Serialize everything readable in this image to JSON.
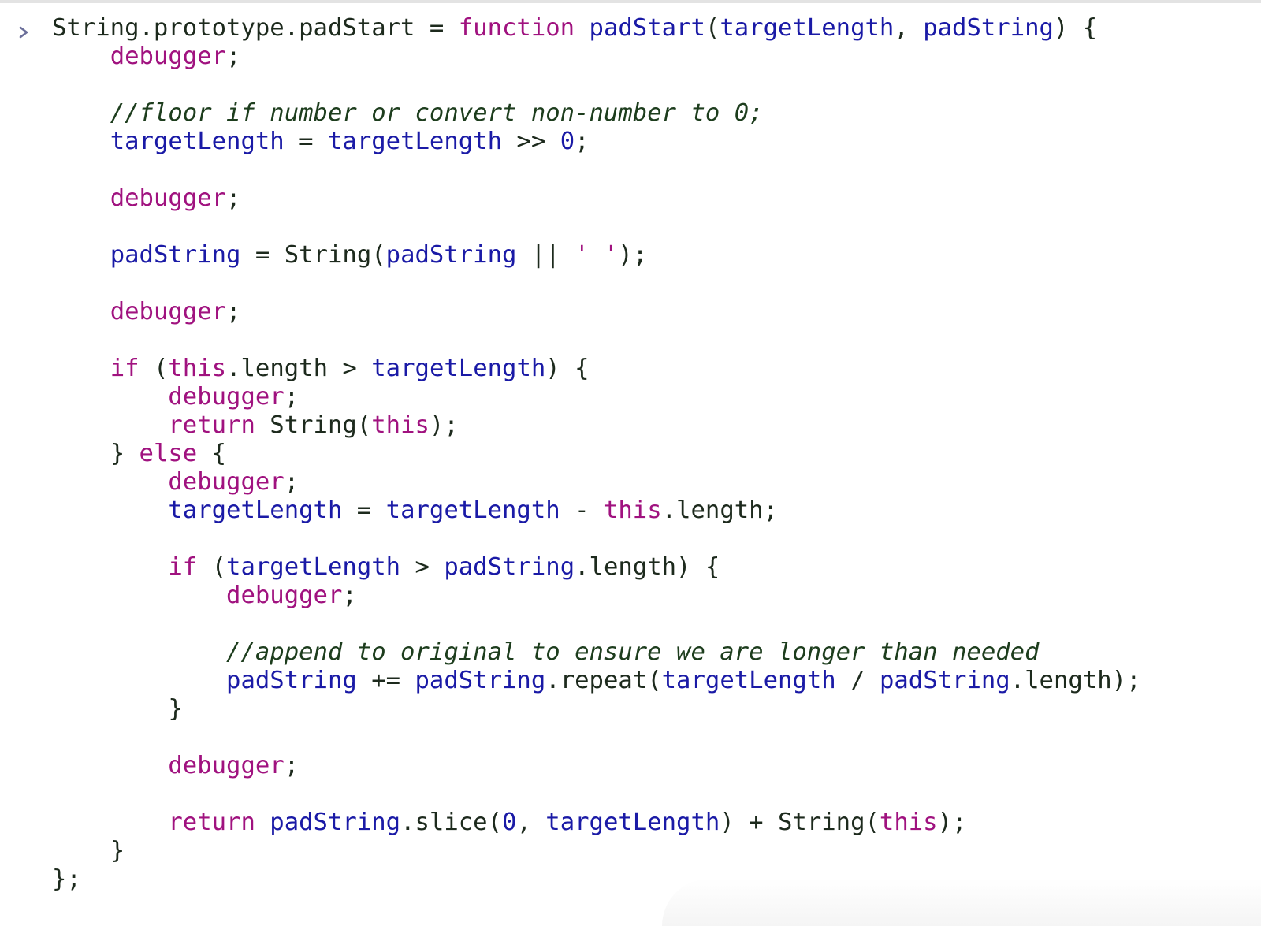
{
  "console": {
    "prompt_icon": "chevron-right-icon",
    "colors": {
      "keyword": "#a0127f",
      "variable": "#1a1aa6",
      "plain": "#1d2a1d",
      "comment": "#1d3d1d"
    },
    "lines": [
      {
        "indent": 0,
        "tokens": [
          {
            "t": "String.prototype.",
            "c": "plain"
          },
          {
            "t": "padStart",
            "c": "plain"
          },
          {
            "t": " = ",
            "c": "plain"
          },
          {
            "t": "function",
            "c": "kw"
          },
          {
            "t": " ",
            "c": "plain"
          },
          {
            "t": "padStart",
            "c": "var"
          },
          {
            "t": "(",
            "c": "plain"
          },
          {
            "t": "targetLength",
            "c": "var"
          },
          {
            "t": ", ",
            "c": "plain"
          },
          {
            "t": "padString",
            "c": "var"
          },
          {
            "t": ") {",
            "c": "plain"
          }
        ]
      },
      {
        "indent": 1,
        "tokens": [
          {
            "t": "debugger",
            "c": "kw"
          },
          {
            "t": ";",
            "c": "plain"
          }
        ]
      },
      {
        "indent": 0,
        "tokens": []
      },
      {
        "indent": 1,
        "tokens": [
          {
            "t": "//floor if number or convert non-number to 0;",
            "c": "comment"
          }
        ]
      },
      {
        "indent": 1,
        "tokens": [
          {
            "t": "targetLength",
            "c": "var"
          },
          {
            "t": " = ",
            "c": "plain"
          },
          {
            "t": "targetLength",
            "c": "var"
          },
          {
            "t": " >> ",
            "c": "plain"
          },
          {
            "t": "0",
            "c": "num"
          },
          {
            "t": ";",
            "c": "plain"
          }
        ]
      },
      {
        "indent": 0,
        "tokens": []
      },
      {
        "indent": 1,
        "tokens": [
          {
            "t": "debugger",
            "c": "kw"
          },
          {
            "t": ";",
            "c": "plain"
          }
        ]
      },
      {
        "indent": 0,
        "tokens": []
      },
      {
        "indent": 1,
        "tokens": [
          {
            "t": "padString",
            "c": "var"
          },
          {
            "t": " = String(",
            "c": "plain"
          },
          {
            "t": "padString",
            "c": "var"
          },
          {
            "t": " || ",
            "c": "plain"
          },
          {
            "t": "' '",
            "c": "str"
          },
          {
            "t": ");",
            "c": "plain"
          }
        ]
      },
      {
        "indent": 0,
        "tokens": []
      },
      {
        "indent": 1,
        "tokens": [
          {
            "t": "debugger",
            "c": "kw"
          },
          {
            "t": ";",
            "c": "plain"
          }
        ]
      },
      {
        "indent": 0,
        "tokens": []
      },
      {
        "indent": 1,
        "tokens": [
          {
            "t": "if",
            "c": "kw"
          },
          {
            "t": " (",
            "c": "plain"
          },
          {
            "t": "this",
            "c": "kw"
          },
          {
            "t": ".length > ",
            "c": "plain"
          },
          {
            "t": "targetLength",
            "c": "var"
          },
          {
            "t": ") {",
            "c": "plain"
          }
        ]
      },
      {
        "indent": 2,
        "tokens": [
          {
            "t": "debugger",
            "c": "kw"
          },
          {
            "t": ";",
            "c": "plain"
          }
        ]
      },
      {
        "indent": 2,
        "tokens": [
          {
            "t": "return",
            "c": "kw"
          },
          {
            "t": " String(",
            "c": "plain"
          },
          {
            "t": "this",
            "c": "kw"
          },
          {
            "t": ");",
            "c": "plain"
          }
        ]
      },
      {
        "indent": 1,
        "tokens": [
          {
            "t": "} ",
            "c": "plain"
          },
          {
            "t": "else",
            "c": "kw"
          },
          {
            "t": " {",
            "c": "plain"
          }
        ]
      },
      {
        "indent": 2,
        "tokens": [
          {
            "t": "debugger",
            "c": "kw"
          },
          {
            "t": ";",
            "c": "plain"
          }
        ]
      },
      {
        "indent": 2,
        "tokens": [
          {
            "t": "targetLength",
            "c": "var"
          },
          {
            "t": " = ",
            "c": "plain"
          },
          {
            "t": "targetLength",
            "c": "var"
          },
          {
            "t": " - ",
            "c": "plain"
          },
          {
            "t": "this",
            "c": "kw"
          },
          {
            "t": ".length;",
            "c": "plain"
          }
        ]
      },
      {
        "indent": 0,
        "tokens": []
      },
      {
        "indent": 2,
        "tokens": [
          {
            "t": "if",
            "c": "kw"
          },
          {
            "t": " (",
            "c": "plain"
          },
          {
            "t": "targetLength",
            "c": "var"
          },
          {
            "t": " > ",
            "c": "plain"
          },
          {
            "t": "padString",
            "c": "var"
          },
          {
            "t": ".length) {",
            "c": "plain"
          }
        ]
      },
      {
        "indent": 3,
        "tokens": [
          {
            "t": "debugger",
            "c": "kw"
          },
          {
            "t": ";",
            "c": "plain"
          }
        ]
      },
      {
        "indent": 0,
        "tokens": []
      },
      {
        "indent": 3,
        "tokens": [
          {
            "t": "//append to original to ensure we are longer than needed",
            "c": "comment"
          }
        ]
      },
      {
        "indent": 3,
        "tokens": [
          {
            "t": "padString",
            "c": "var"
          },
          {
            "t": " += ",
            "c": "plain"
          },
          {
            "t": "padString",
            "c": "var"
          },
          {
            "t": ".repeat(",
            "c": "plain"
          },
          {
            "t": "targetLength",
            "c": "var"
          },
          {
            "t": " / ",
            "c": "plain"
          },
          {
            "t": "padString",
            "c": "var"
          },
          {
            "t": ".length);",
            "c": "plain"
          }
        ]
      },
      {
        "indent": 2,
        "tokens": [
          {
            "t": "}",
            "c": "plain"
          }
        ]
      },
      {
        "indent": 0,
        "tokens": []
      },
      {
        "indent": 2,
        "tokens": [
          {
            "t": "debugger",
            "c": "kw"
          },
          {
            "t": ";",
            "c": "plain"
          }
        ]
      },
      {
        "indent": 0,
        "tokens": []
      },
      {
        "indent": 2,
        "tokens": [
          {
            "t": "return",
            "c": "kw"
          },
          {
            "t": " ",
            "c": "plain"
          },
          {
            "t": "padString",
            "c": "var"
          },
          {
            "t": ".slice(",
            "c": "plain"
          },
          {
            "t": "0",
            "c": "num"
          },
          {
            "t": ", ",
            "c": "plain"
          },
          {
            "t": "targetLength",
            "c": "var"
          },
          {
            "t": ") + String(",
            "c": "plain"
          },
          {
            "t": "this",
            "c": "kw"
          },
          {
            "t": ");",
            "c": "plain"
          }
        ]
      },
      {
        "indent": 1,
        "tokens": [
          {
            "t": "}",
            "c": "plain"
          }
        ]
      },
      {
        "indent": 0,
        "tokens": [
          {
            "t": "};",
            "c": "plain"
          }
        ]
      }
    ]
  }
}
